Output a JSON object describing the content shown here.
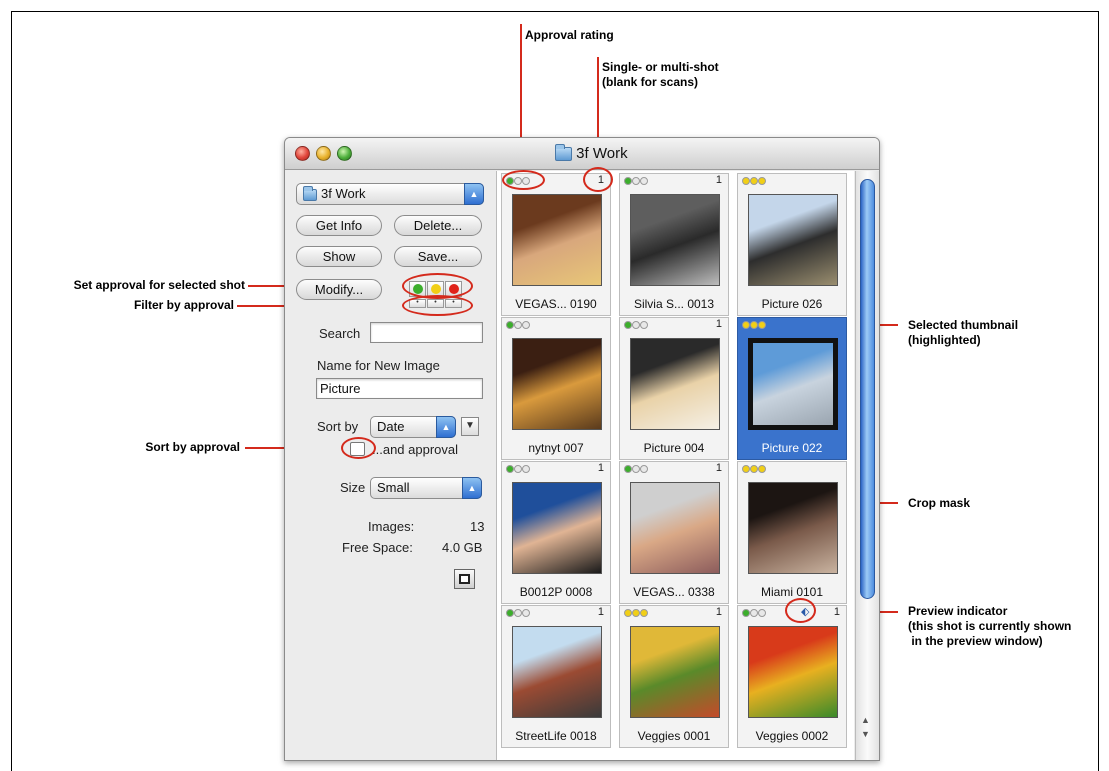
{
  "annotations": {
    "approval_rating": "Approval rating",
    "single_multi_1": "Single- or multi-shot",
    "single_multi_2": "(blank for scans)",
    "set_approval": "Set approval for selected shot",
    "filter_by_approval": "Filter by approval",
    "sort_by_approval": "Sort by approval",
    "selected_thumbnail_1": "Selected thumbnail",
    "selected_thumbnail_2": "(highlighted)",
    "crop_mask": "Crop mask",
    "preview_indicator_1": "Preview indicator",
    "preview_indicator_2": "(this shot is currently shown",
    "preview_indicator_3": " in the preview window)"
  },
  "window": {
    "title": "3f Work"
  },
  "sidebar": {
    "folder_popup": "3f Work",
    "get_info": "Get Info",
    "delete": "Delete...",
    "show": "Show",
    "save": "Save...",
    "modify": "Modify...",
    "search_label": "Search",
    "search_value": "",
    "new_image_label": "Name for New Image",
    "new_image_value": "Picture",
    "sort_by_label": "Sort by",
    "sort_by_value": "Date",
    "and_approval": "...and approval",
    "size_label": "Size",
    "size_value": "Small",
    "images_label": "Images:",
    "images_value": "13",
    "free_space_label": "Free Space:",
    "free_space_value": "4.0 GB"
  },
  "approval_colors": {
    "green": "#3cae2c",
    "yellow": "#f1cf16",
    "red": "#e0231a",
    "blank": "#e8e8e8"
  },
  "thumbnails": [
    {
      "name": "VEGAS... 0190",
      "shot": "1",
      "approval": "green",
      "selected": false,
      "colors": [
        "#6b3a1e",
        "#d8a77c",
        "#e8c778"
      ]
    },
    {
      "name": "Silvia S... 0013",
      "shot": "1",
      "approval": "green",
      "selected": false,
      "colors": [
        "#5e5e5e",
        "#2a2a2a",
        "#bdbdbd"
      ]
    },
    {
      "name": "Picture 026",
      "shot": "",
      "approval": "yellow",
      "selected": false,
      "colors": [
        "#c4d6ea",
        "#2d2d2d",
        "#9a8e6f"
      ]
    },
    {
      "name": "nytnyt 007",
      "shot": "",
      "approval": "green",
      "selected": false,
      "colors": [
        "#3b1f12",
        "#d99a3d",
        "#5a3a1c"
      ]
    },
    {
      "name": "Picture 004",
      "shot": "1",
      "approval": "green",
      "selected": false,
      "colors": [
        "#2a2a2a",
        "#e9d2a8",
        "#f5f0e6"
      ]
    },
    {
      "name": "Picture 022",
      "shot": "",
      "approval": "yellow",
      "selected": true,
      "colors": [
        "#5e9bd8",
        "#c8d3de",
        "#9aa5b0"
      ]
    },
    {
      "name": "B0012P 0008",
      "shot": "1",
      "approval": "green",
      "selected": false,
      "colors": [
        "#1f4f9b",
        "#e0b494",
        "#1a1a1a"
      ]
    },
    {
      "name": "VEGAS... 0338",
      "shot": "1",
      "approval": "green",
      "selected": false,
      "colors": [
        "#cfcfcf",
        "#d9a886",
        "#8c5c5c"
      ]
    },
    {
      "name": "Miami 0101",
      "shot": "",
      "approval": "yellow",
      "selected": false,
      "colors": [
        "#1c1512",
        "#7a5a4a",
        "#c9b3a0"
      ]
    },
    {
      "name": "StreetLife 0018",
      "shot": "1",
      "approval": "green",
      "selected": false,
      "colors": [
        "#c3dcef",
        "#9b4b33",
        "#3a3a3a"
      ]
    },
    {
      "name": "Veggies 0001",
      "shot": "1",
      "approval": "yellow",
      "selected": false,
      "colors": [
        "#e0b838",
        "#5a8a2a",
        "#c44a2a"
      ]
    },
    {
      "name": "Veggies 0002",
      "shot": "1",
      "approval": "green",
      "selected": false,
      "preview": true,
      "colors": [
        "#d83a1a",
        "#e8b020",
        "#3a8a2a"
      ]
    }
  ]
}
